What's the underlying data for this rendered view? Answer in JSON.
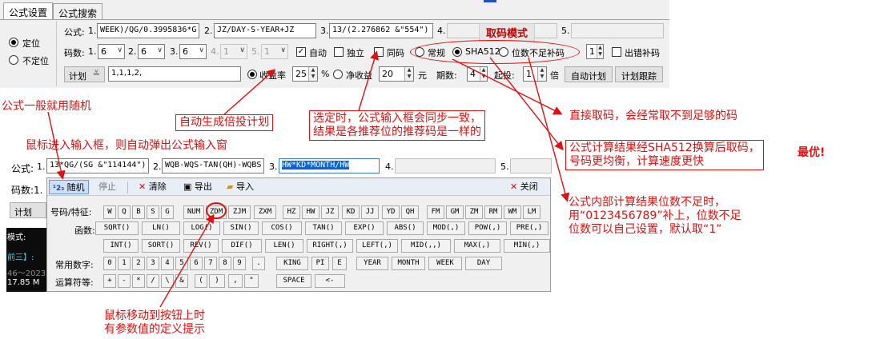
{
  "tabs": [
    "公式设置",
    "公式搜索"
  ],
  "positioning": {
    "fixed": "定位",
    "unfixed": "不定位"
  },
  "formula_row": {
    "label": "公式:",
    "items": [
      {
        "n": "1.",
        "value": "WEEK)/QG/0.3995836*G"
      },
      {
        "n": "2.",
        "value": "JZ/DAY-S-YEAR+JZ"
      },
      {
        "n": "3.",
        "value": "13/(2.276862 &\"554\")"
      },
      {
        "n": "4.",
        "value": ""
      },
      {
        "n": "5.",
        "value": ""
      }
    ],
    "mode_caption": "取码模式"
  },
  "code_row": {
    "label": "码数:",
    "items": [
      {
        "n": "1.",
        "value": "6"
      },
      {
        "n": "2.",
        "value": "6"
      },
      {
        "n": "3.",
        "value": "6"
      },
      {
        "n": "4.",
        "value": "1"
      },
      {
        "n": "5.",
        "value": "1"
      }
    ],
    "auto": "自动",
    "independent": "独立",
    "same_code": "同码",
    "normal": "常规",
    "sha512": "SHA512",
    "pad": "位数不足补码",
    "pad_value": "1",
    "error_pad": "出错补码"
  },
  "plan_row": {
    "plan": "计划",
    "plan_value": "1,1,1,2,",
    "yield": "收益率",
    "yield_value": "25",
    "percent": "%",
    "net": "净收益",
    "net_value": "20",
    "yuan": "元",
    "periods": "期数:",
    "periods_value": "4",
    "start": "起投:",
    "start_value": "1",
    "times": "倍",
    "auto_plan": "自动计划",
    "plan_track": "计划跟踪"
  },
  "annotations": {
    "random": "公式一般就用随机",
    "auto_plan": "自动生成倍投计划",
    "same_code": [
      "选定时，公式输入框会同步一致，",
      "结果是各推荐位的推荐码是一样的"
    ],
    "direct": "直接取码，会经常取不到足够的码",
    "sha": [
      "公式计算结果经SHA512换算后取码，",
      "号码更均衡，计算速度更快"
    ],
    "best": "最优!",
    "popup_hint": "鼠标进入输入框，则自动弹出公式输入窗",
    "pad": [
      "公式内部计算结果位数不足时，",
      "用“0123456789”补上，位数不足",
      "位数可以自己设置，默认取“1”"
    ],
    "hover": [
      "鼠标移动到按钮上时",
      "有参数值的定义提示"
    ]
  },
  "second_formula": {
    "label": "公式:",
    "items": [
      {
        "n": "1.",
        "value": "13*QG/(SG &\"114144\")"
      },
      {
        "n": "2.",
        "value": "WQB-WQS-TAN(QH)-WQBS"
      },
      {
        "n": "3.",
        "value": "HW*KD*MONTH/HW"
      },
      {
        "n": "4.",
        "value": ""
      },
      {
        "n": "5.",
        "value": ""
      }
    ],
    "code_label": "码数:1.",
    "plan": "计划"
  },
  "popup": {
    "toolbar": {
      "random": "随机",
      "stop": "停止",
      "clear": "清除",
      "export": "导出",
      "import": "导入",
      "close": "关闭"
    },
    "rows": {
      "codes": "号码/特征:",
      "funcs": "函数:",
      "nums": "常用数字:",
      "ops": "运算符等:"
    },
    "codes": [
      "W",
      "Q",
      "B",
      "S",
      "G",
      "NUM",
      "ZDM",
      "ZJM",
      "ZXM",
      "HZ",
      "HW",
      "JZ",
      "KD",
      "JJ",
      "YD",
      "QH",
      "FM",
      "GM",
      "ZM",
      "RM",
      "WM",
      "LM"
    ],
    "funcs1": [
      "SQRT()",
      "LN()",
      "LOG()",
      "SIN()",
      "COS()",
      "TAN()",
      "EXP()",
      "ABS()",
      "MOD(,)",
      "POW(,)",
      "PRE(,)"
    ],
    "funcs2": [
      "INT()",
      "SORT()",
      "REV()",
      "DIF()",
      "LEN()",
      "RIGHT(,)",
      "LEFT(,)",
      "MID(,,)",
      "MAX(,)",
      "MIN(,)"
    ],
    "nums": [
      "0",
      "1",
      "2",
      "3",
      "4",
      "5",
      "6",
      "7",
      "8",
      "9",
      "."
    ],
    "consts": [
      "KING",
      "PI",
      "E",
      "YEAR",
      "MONTH",
      "WEEK",
      "DAY"
    ],
    "ops": [
      "+",
      "-",
      "*",
      "/",
      "\\",
      "&",
      "(",
      ")",
      ",",
      "\"",
      "SPACE",
      "<-"
    ]
  },
  "dark": {
    "line1": "模式:",
    "line2": "前三】:",
    "line3": "46～2023",
    "line4": "17.85  M"
  },
  "colors": {
    "annotation": "#e01010",
    "panel": "#f0f0f0",
    "selection": "#0a64d8"
  }
}
